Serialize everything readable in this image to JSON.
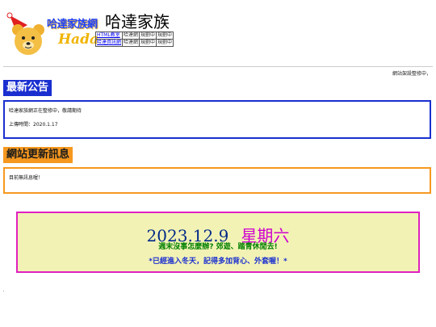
{
  "header": {
    "logo_title": "哈達家族網",
    "logo_hada": "Hada",
    "site_title": "哈達家族"
  },
  "nav": {
    "rows": [
      [
        {
          "label": "HTML教室",
          "link": true
        },
        {
          "label": "哈達網",
          "link": false
        },
        {
          "label": "規劃中",
          "link": false
        },
        {
          "label": "規劃中",
          "link": false
        }
      ],
      [
        {
          "label": "哈達資訊網",
          "link": true
        },
        {
          "label": "哈達網",
          "link": false
        },
        {
          "label": "規劃中",
          "link": false
        },
        {
          "label": "規劃中",
          "link": false
        }
      ]
    ]
  },
  "marquee_text": "網站架設整修中，",
  "announcement": {
    "title": "最新公告",
    "line1": "哈達家族網正在整修中，敬請期待",
    "line2": "上傳時間：2020.1.17"
  },
  "updates": {
    "title": "網站更新訊息",
    "line1": "目前無訊息喔！"
  },
  "date_panel": {
    "date": "2023.12.9",
    "weekday": "星期六",
    "message1": "週末沒事怎麼辦? 郊遊、踏青休閒去!",
    "message2": "*已經進入冬天，記得多加背心、外套喔！*"
  },
  "colors": {
    "announcement_accent": "#1a2fd0",
    "updates_accent": "#f6981f",
    "date_panel_bg": "#f2f2b5",
    "date_panel_border": "#e020c0"
  }
}
